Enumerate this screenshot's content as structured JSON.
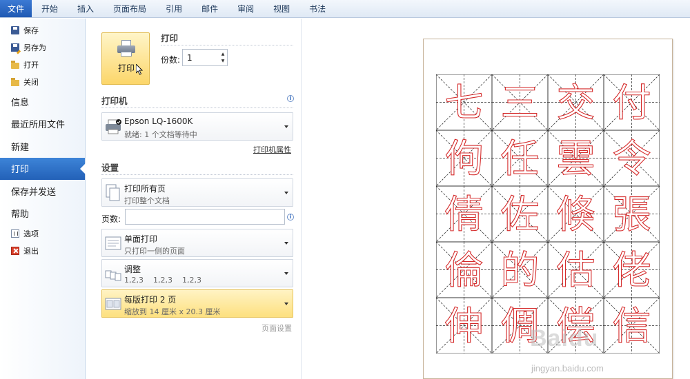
{
  "ribbon": {
    "tabs": [
      "文件",
      "开始",
      "插入",
      "页面布局",
      "引用",
      "邮件",
      "审阅",
      "视图",
      "书法"
    ]
  },
  "nav": {
    "small_top": [
      {
        "label": "保存",
        "icon": "save-icon"
      },
      {
        "label": "另存为",
        "icon": "save-as-icon"
      },
      {
        "label": "打开",
        "icon": "open-folder-icon"
      },
      {
        "label": "关闭",
        "icon": "close-folder-icon"
      }
    ],
    "big": [
      "信息",
      "最近所用文件",
      "新建",
      "打印",
      "保存并发送",
      "帮助"
    ],
    "active": "打印",
    "small_bottom": [
      {
        "label": "选项",
        "icon": "options-icon"
      },
      {
        "label": "退出",
        "icon": "exit-icon"
      }
    ]
  },
  "print": {
    "button_label": "打印",
    "section_title": "打印",
    "copies_label": "份数:",
    "copies_value": "1"
  },
  "printer": {
    "section_title": "打印机",
    "name": "Epson LQ-1600K",
    "status": "就绪: 1 个文档等待中",
    "properties_link": "打印机属性"
  },
  "settings": {
    "section_title": "设置",
    "pages_label": "页数:",
    "pages_value": "",
    "dropdowns": [
      {
        "title": "打印所有页",
        "subtitle": "打印整个文档"
      },
      {
        "title": "单面打印",
        "subtitle": "只打印一侧的页面"
      },
      {
        "title": "调整",
        "subtitle": "1,2,3    1,2,3    1,2,3"
      },
      {
        "title": "每版打印 2 页",
        "subtitle": "缩放到 14 厘米 x 20.3 厘米"
      }
    ],
    "page_setup_link": "页面设置"
  },
  "preview": {
    "characters": [
      "七",
      "三",
      "交",
      "付",
      "佝",
      "任",
      "雲",
      "令",
      "倩",
      "佐",
      "倏",
      "張",
      "倫",
      "的",
      "估",
      "佬",
      "伸",
      "倜",
      "偿",
      "信"
    ],
    "glyph_color": "#d52b2b",
    "watermark": "Baidu",
    "watermark_sub": "jingyan.baidu.com"
  },
  "colors": {
    "file_tab": "#2a66c2",
    "nav_active": "#2d6fc6",
    "highlight": "#fde07f"
  }
}
